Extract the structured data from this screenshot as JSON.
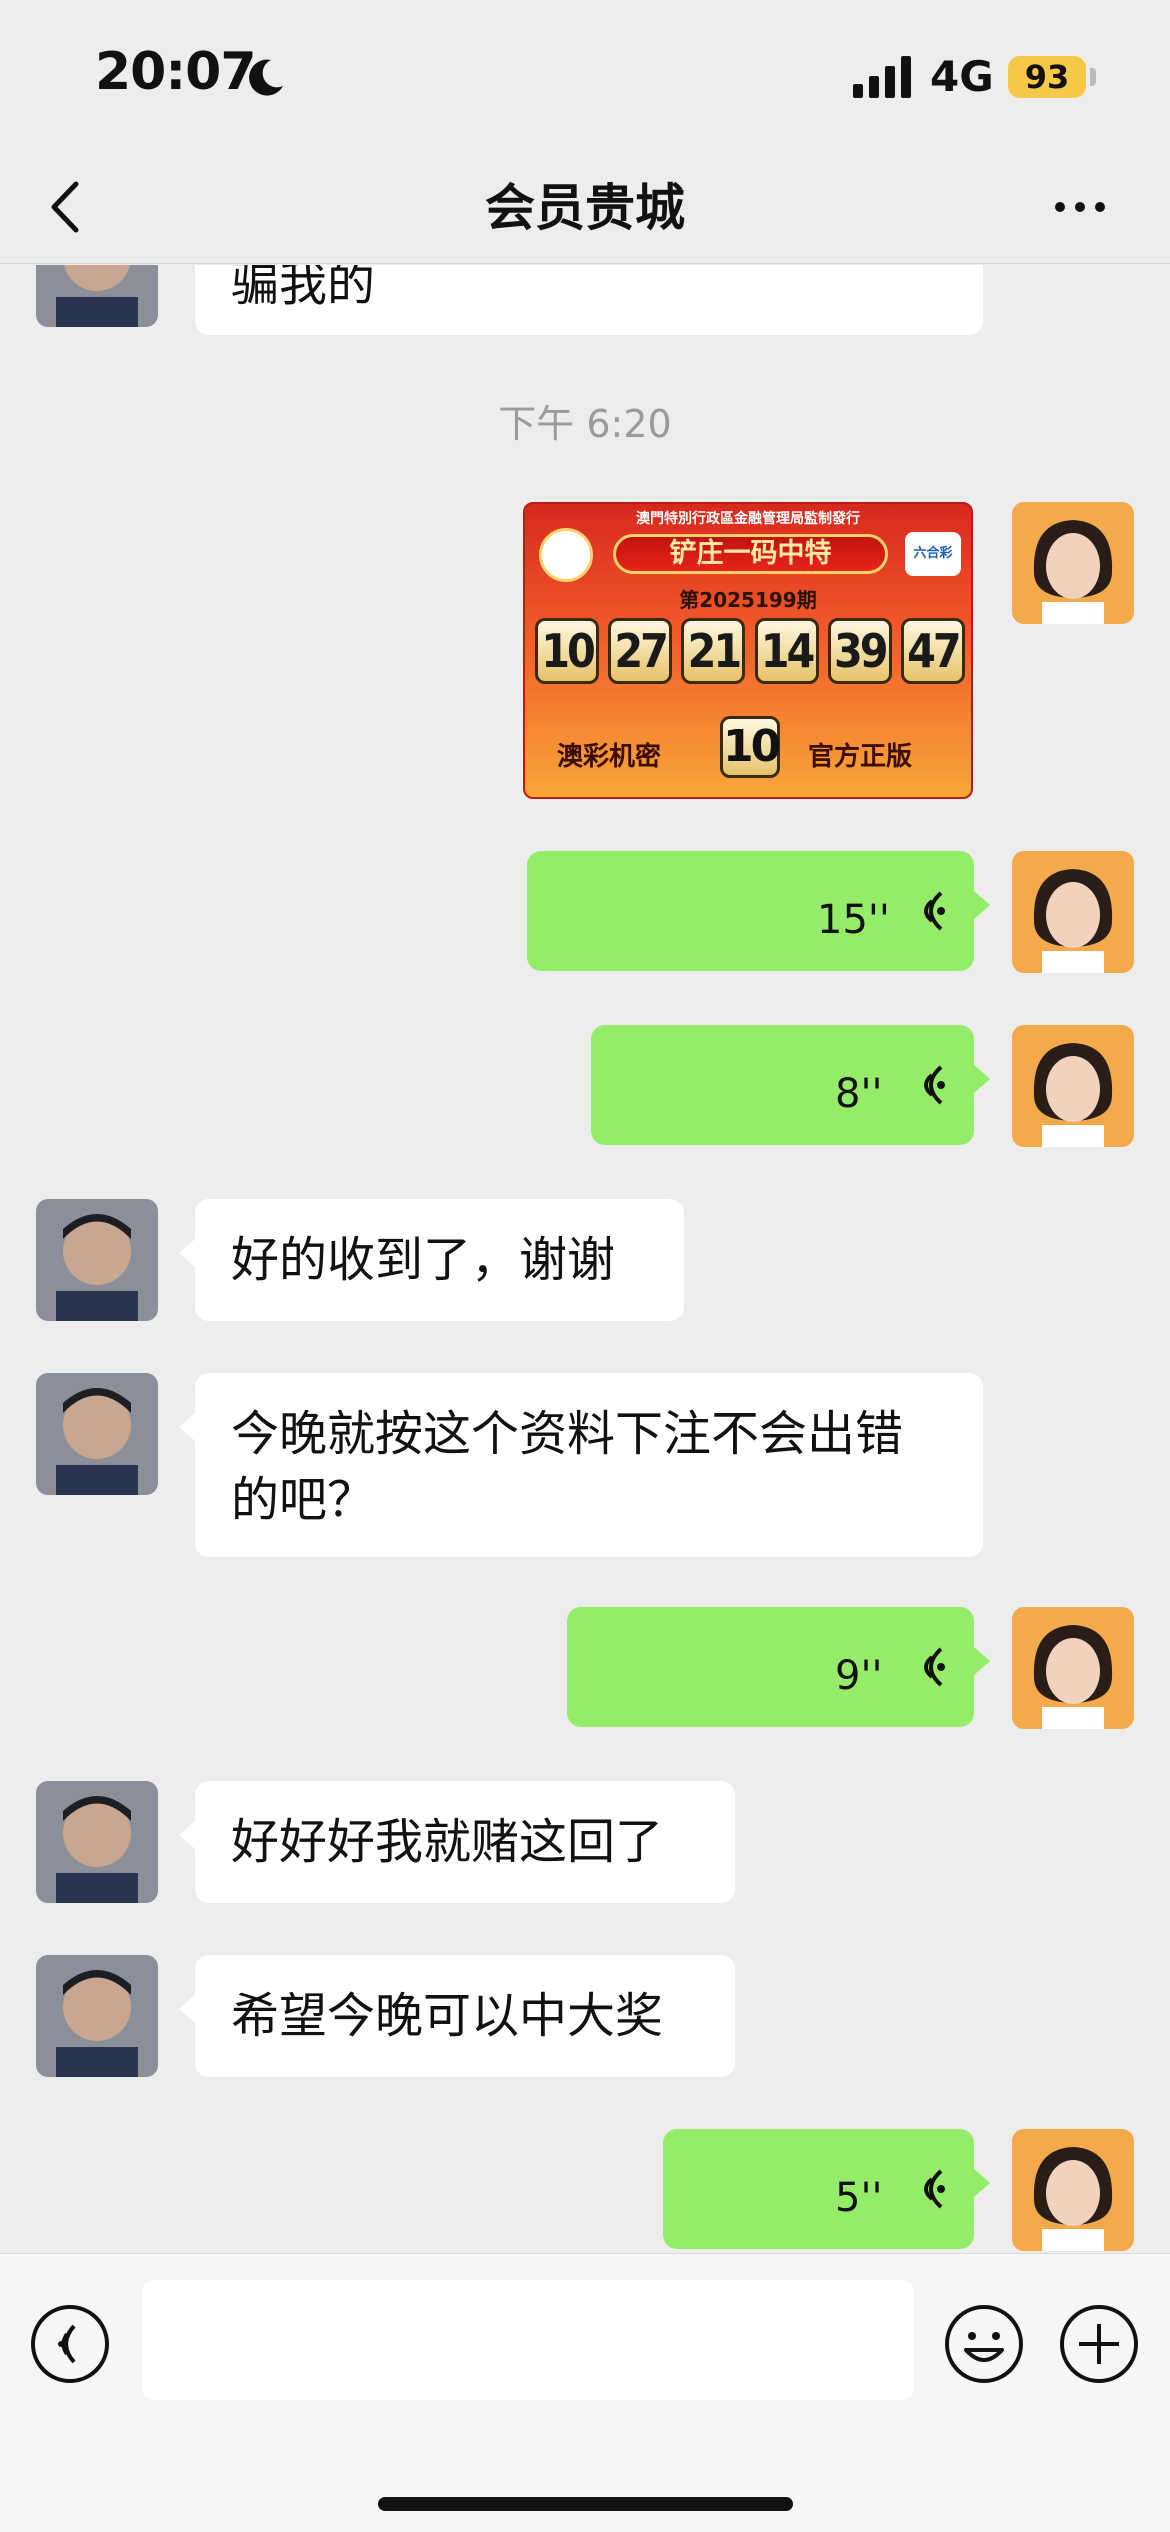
{
  "status_bar": {
    "time": "20:07",
    "network": "4G",
    "battery": "93"
  },
  "nav": {
    "title": "会员贵城"
  },
  "messages": {
    "m0": {
      "side": "incoming",
      "text": "骗我的"
    },
    "timestamp": "下午 6:20",
    "image": {
      "side": "outgoing",
      "header": "澳門特別行政區金融管理局監制發行",
      "banner": "铲庄一码中特",
      "logo": "六合彩",
      "issue": "第2025199期",
      "numbers": [
        "10",
        "27",
        "21",
        "14",
        "39",
        "47"
      ],
      "bottom_left": "澳彩机密",
      "special": "10",
      "bottom_right": "官方正版"
    },
    "v1": {
      "side": "outgoing",
      "duration": "15''"
    },
    "v2": {
      "side": "outgoing",
      "duration": "8''"
    },
    "m3": {
      "side": "incoming",
      "text": "好的收到了，谢谢"
    },
    "m4": {
      "side": "incoming",
      "text": "今晚就按这个资料下注不会出错的吧？"
    },
    "v5": {
      "side": "outgoing",
      "duration": "9''"
    },
    "m6": {
      "side": "incoming",
      "text": "好好好我就赌这回了"
    },
    "m7": {
      "side": "incoming",
      "text": "希望今晚可以中大奖"
    },
    "v8": {
      "side": "outgoing",
      "duration": "5''"
    }
  },
  "input_bar": {
    "placeholder": ""
  },
  "colors": {
    "outgoing_bubble": "#95ec69",
    "incoming_bubble": "#ffffff",
    "background": "#ededed",
    "battery": "#f7c948"
  }
}
